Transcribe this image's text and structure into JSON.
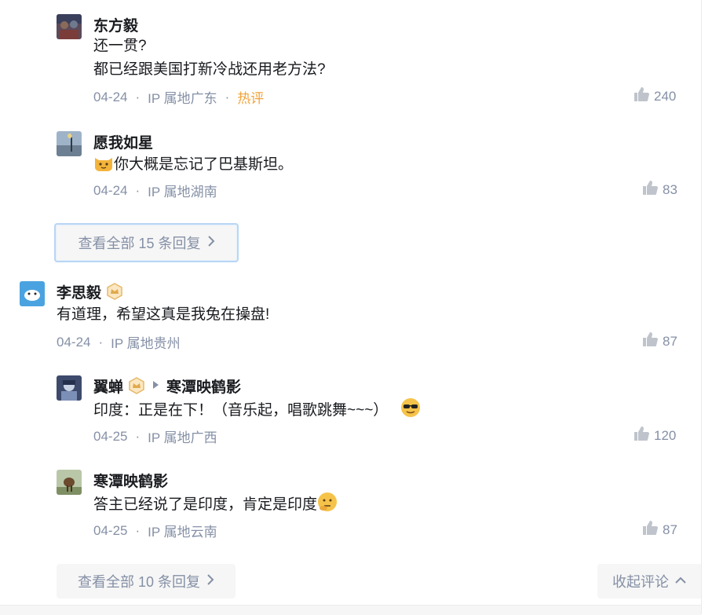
{
  "comments": [
    {
      "name": "东方毅",
      "lines": [
        "还一贯?",
        "都已经跟美国打新冷战还用老方法?"
      ],
      "date": "04-24",
      "ip": "IP 属地广东",
      "tag": "热评",
      "likes": "240"
    },
    {
      "name": "愿我如星",
      "text": "你大概是忘记了巴基斯坦。",
      "date": "04-24",
      "ip": "IP 属地湖南",
      "likes": "83"
    },
    {
      "name": "李思毅",
      "text": "有道理，希望这真是我兔在操盘!",
      "date": "04-24",
      "ip": "IP 属地贵州",
      "likes": "87"
    },
    {
      "name": "翼蝉",
      "reply_to": "寒潭映鹤影",
      "text": "印度：正是在下！（音乐起，唱歌跳舞~~~）",
      "date": "04-25",
      "ip": "IP 属地广西",
      "likes": "120"
    },
    {
      "name": "寒潭映鹤影",
      "text": "答主已经说了是印度，肯定是印度",
      "date": "04-25",
      "ip": "IP 属地云南",
      "likes": "87"
    }
  ],
  "buttons": {
    "view_all_15": "查看全部 15 条回复",
    "view_all_10": "查看全部 10 条回复",
    "collapse": "收起评论"
  },
  "separator": "·",
  "icons": {
    "like": "thumbs-up-icon",
    "badge": "crown-badge-icon",
    "chevron_right": "chevron-right-icon",
    "chevron_up": "chevron-up-icon",
    "reply_arrow": "triangle-right-icon"
  },
  "colors": {
    "text": "#191b1f",
    "meta": "#8590a6",
    "hot": "#f1a339",
    "button_bg": "#f6f6f6",
    "badge": "#e6b96a"
  }
}
